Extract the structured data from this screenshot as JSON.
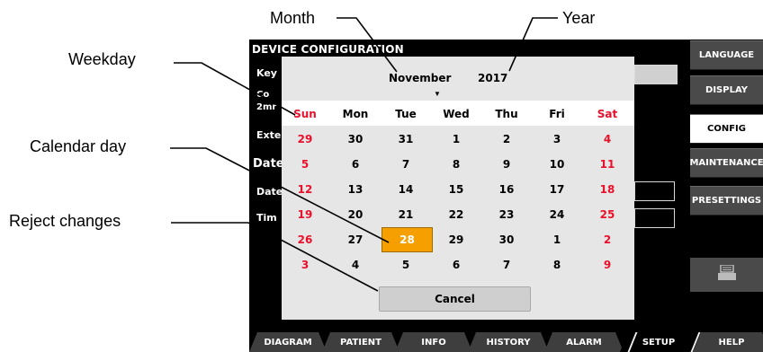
{
  "annotations": {
    "month": "Month",
    "year": "Year",
    "weekday": "Weekday",
    "calendar_day": "Calendar day",
    "reject_changes": "Reject changes"
  },
  "device": {
    "title": "DEVICE CONFIGURATION",
    "background_labels": [
      "Key",
      "Co",
      "2mr",
      "Exte",
      "Date",
      "Date",
      "Tim"
    ]
  },
  "right_panel": {
    "items": [
      {
        "label": "LANGUAGE",
        "active": false
      },
      {
        "label": "DISPLAY",
        "active": false
      },
      {
        "label": "CONFIG",
        "active": true
      },
      {
        "label": "MAINTENANCE",
        "active": false
      },
      {
        "label": "PRESETTINGS",
        "active": false
      }
    ],
    "printer_icon": "printer-icon"
  },
  "tabs": [
    {
      "label": "DIAGRAM",
      "active": false
    },
    {
      "label": "PATIENT",
      "active": false
    },
    {
      "label": "INFO",
      "active": false
    },
    {
      "label": "HISTORY",
      "active": false
    },
    {
      "label": "ALARM",
      "active": false
    },
    {
      "label": "SETUP",
      "active": true
    },
    {
      "label": "HELP",
      "active": false
    }
  ],
  "calendar": {
    "month": "November",
    "year": "2017",
    "dropdown_icon": "triangle-down-icon",
    "weekdays": [
      "Sun",
      "Mon",
      "Tue",
      "Wed",
      "Thu",
      "Fri",
      "Sat"
    ],
    "weeks": [
      [
        "29",
        "30",
        "31",
        "1",
        "2",
        "3",
        "4"
      ],
      [
        "5",
        "6",
        "7",
        "8",
        "9",
        "10",
        "11"
      ],
      [
        "12",
        "13",
        "14",
        "15",
        "16",
        "17",
        "18"
      ],
      [
        "19",
        "20",
        "21",
        "22",
        "23",
        "24",
        "25"
      ],
      [
        "26",
        "27",
        "28",
        "29",
        "30",
        "1",
        "2"
      ],
      [
        "3",
        "4",
        "5",
        "6",
        "7",
        "8",
        "9"
      ]
    ],
    "selected_day": "28",
    "cancel_label": "Cancel",
    "colors": {
      "weekend": "#e8102a",
      "selected": "#f5a000"
    }
  }
}
